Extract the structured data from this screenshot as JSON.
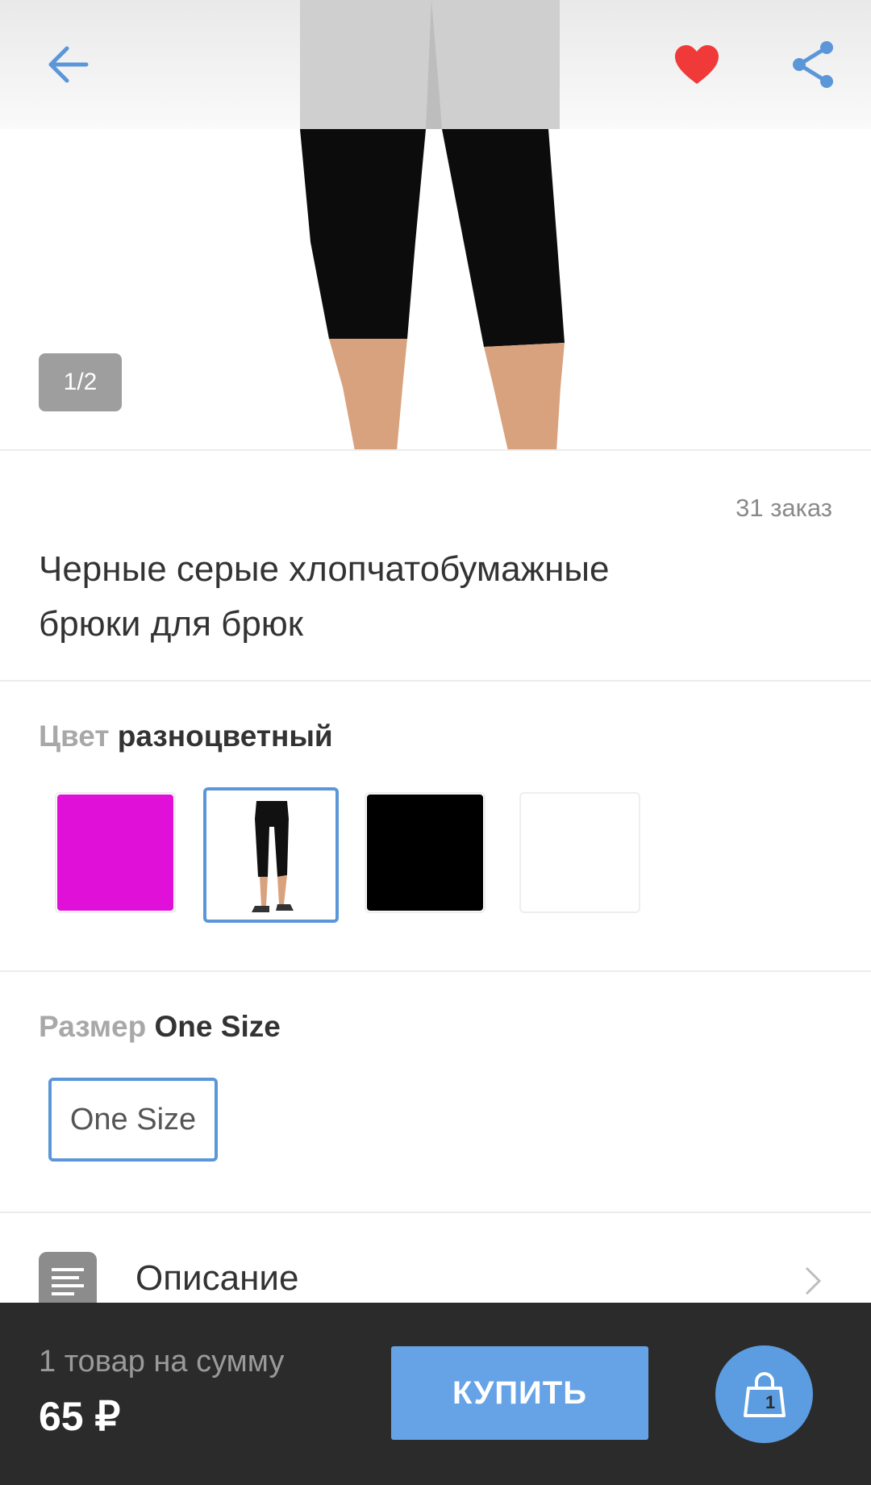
{
  "gallery": {
    "counter": "1/2"
  },
  "product": {
    "orders": "31 заказ",
    "title_line1": "Черные серые хлопчатобумажные",
    "title_line2": "брюки для брюк"
  },
  "color": {
    "label": "Цвет",
    "value": "разноцветный",
    "swatches": [
      {
        "name": "magenta",
        "hex": "#e010d8"
      },
      {
        "name": "photo",
        "hex": "#ffffff"
      },
      {
        "name": "black",
        "hex": "#000000"
      },
      {
        "name": "white",
        "hex": "#ffffff"
      }
    ]
  },
  "size": {
    "label": "Размер",
    "value": "One Size",
    "options": [
      "One Size"
    ]
  },
  "description": {
    "label": "Описание"
  },
  "bottom": {
    "sum_label": "1 товар на сумму",
    "sum_value": "65 ₽",
    "buy_label": "КУПИТЬ",
    "cart_count": "1"
  },
  "colors": {
    "accent": "#5b97d8",
    "favorite": "#f03a3a",
    "buy": "#66a3e6",
    "bar": "#2b2b2b"
  },
  "icons": [
    "back-arrow-icon",
    "heart-icon",
    "share-icon",
    "description-icon",
    "chevron-right-icon",
    "shopping-bag-icon"
  ]
}
